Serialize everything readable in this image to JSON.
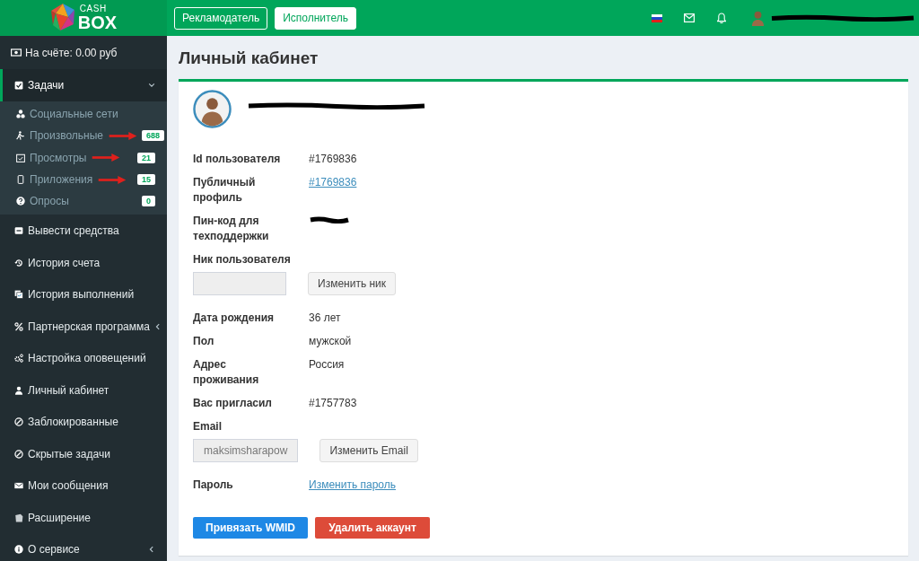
{
  "logo": {
    "line_1": "CASH",
    "line_2": "BOX"
  },
  "header": {
    "tabs": [
      {
        "label": "Рекламодатель",
        "selected": false
      },
      {
        "label": "Исполнитель",
        "selected": true
      }
    ],
    "user": {
      "redacted": true
    }
  },
  "sidebar": {
    "balance": "На счёте: 0.00 руб",
    "items": [
      {
        "kind": "group",
        "label": "Задачи",
        "selected": true,
        "expanded": true,
        "children": [
          {
            "label": "Социальные сети",
            "selected": false,
            "arrow": false
          },
          {
            "label": "Произвольные",
            "selected": false,
            "arrow": true,
            "badge": "688"
          },
          {
            "label": "Просмотры",
            "selected": false,
            "arrow": true,
            "badge": "21"
          },
          {
            "label": "Приложения",
            "selected": false,
            "arrow": true,
            "badge": "15"
          },
          {
            "label": "Опросы",
            "selected": false,
            "arrow": false,
            "badge": "0"
          }
        ]
      },
      {
        "kind": "link",
        "label": "Вывести средства",
        "selected": false
      },
      {
        "kind": "link",
        "label": "История счета",
        "selected": false
      },
      {
        "kind": "link",
        "label": "История выполнений",
        "selected": false
      },
      {
        "kind": "group",
        "label": "Партнерская программа",
        "selected": false,
        "expanded": false
      },
      {
        "kind": "link",
        "label": "Настройка оповещений",
        "selected": false
      },
      {
        "kind": "link",
        "label": "Личный кабинет",
        "selected": false
      },
      {
        "kind": "link",
        "label": "Заблокированные",
        "selected": false
      },
      {
        "kind": "link",
        "label": "Скрытые задачи",
        "selected": false
      },
      {
        "kind": "link",
        "label": "Мои сообщения",
        "selected": false
      },
      {
        "kind": "link",
        "label": "Расширение",
        "selected": false
      },
      {
        "kind": "group",
        "label": "О сервисе",
        "selected": false,
        "expanded": false
      }
    ]
  },
  "page_title": "Личный кабинет",
  "profile": {
    "user": {
      "redacted": true
    },
    "rows": [
      {
        "kind": "text",
        "label": "Id пользователя",
        "value": "#1769836"
      },
      {
        "kind": "link",
        "label": "Публичный профиль",
        "value": "#1769836"
      },
      {
        "kind": "redacted",
        "label": "Пин-код для техподдержки"
      },
      {
        "kind": "field",
        "label": "Ник пользователя",
        "field": {
          "disabled": true
        },
        "button": "Изменить ник"
      },
      {
        "kind": "text",
        "label": "Дата рождения",
        "value": "36 лет"
      },
      {
        "kind": "text",
        "label": "Пол",
        "value": "мужской"
      },
      {
        "kind": "text",
        "label": "Адрес проживания",
        "value": "Россия"
      },
      {
        "kind": "text",
        "label": "Вас пригласил",
        "value": "#1757783"
      },
      {
        "kind": "field",
        "label": "Email",
        "field": {
          "value": "maksimsharapow",
          "disabled": true
        },
        "button": "Изменить Email"
      },
      {
        "kind": "link",
        "label": "Пароль",
        "value": "Изменить пароль"
      }
    ],
    "actions": [
      {
        "kind": "primary",
        "label": "Привязать WMID"
      },
      {
        "kind": "danger",
        "label": "Удалить аккаунт"
      }
    ]
  }
}
